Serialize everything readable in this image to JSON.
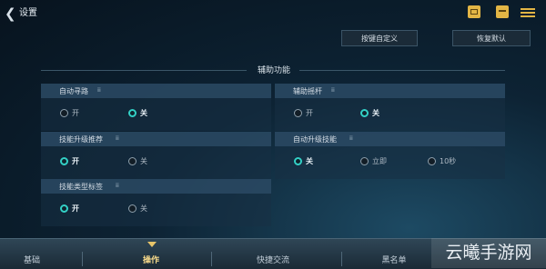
{
  "header": {
    "title": "设置",
    "keybind_button": "按键自定义",
    "reset_button": "恢复默认"
  },
  "section": {
    "title": "辅助功能"
  },
  "settings": [
    {
      "label": "自动寻路",
      "info": "ⅲ",
      "options": [
        {
          "label": "开",
          "selected": false
        },
        {
          "label": "关",
          "selected": true
        }
      ]
    },
    {
      "label": "辅助摇杆",
      "info": "ⅲ",
      "options": [
        {
          "label": "开",
          "selected": false
        },
        {
          "label": "关",
          "selected": true
        }
      ]
    },
    {
      "label": "技能升级推荐",
      "info": "ⅲ",
      "options": [
        {
          "label": "开",
          "selected": true
        },
        {
          "label": "关",
          "selected": false
        }
      ]
    },
    {
      "label": "自动升级技能",
      "info": "ⅲ",
      "options": [
        {
          "label": "关",
          "selected": true
        },
        {
          "label": "立即",
          "selected": false
        },
        {
          "label": "10秒",
          "selected": false
        }
      ]
    },
    {
      "label": "技能类型标签",
      "info": "ⅲ",
      "options": [
        {
          "label": "开",
          "selected": true
        },
        {
          "label": "关",
          "selected": false
        }
      ]
    }
  ],
  "tabs": [
    {
      "label": "基础",
      "active": false
    },
    {
      "label": "操作",
      "active": true
    },
    {
      "label": "快捷交流",
      "active": false
    },
    {
      "label": "黑名单",
      "active": false
    }
  ],
  "watermark": "云曦手游网",
  "colors": {
    "accent": "#33d0c6",
    "active_tab": "#f6d98a",
    "icon_gold": "#e2b545"
  }
}
